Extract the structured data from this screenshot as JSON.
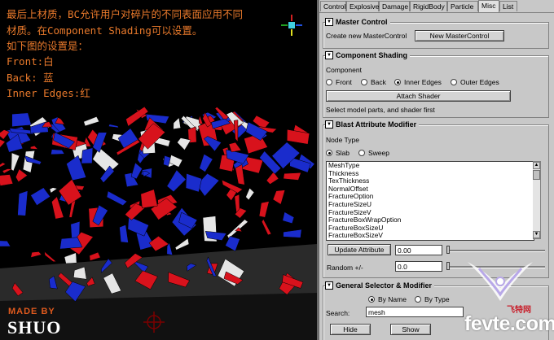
{
  "viewport": {
    "annotation_lines": [
      "最后上材质，BC允许用户对碎片的不同表面应用不同",
      "材质。在Component Shading可以设置。",
      "如下图的设置是：",
      "Front:白",
      "Back: 蓝",
      "Inner Edges:红"
    ],
    "made_by": "MADE BY",
    "signature": "SHUO"
  },
  "tabs": [
    {
      "label": "Control",
      "active": false
    },
    {
      "label": "Explosive",
      "active": false
    },
    {
      "label": "Damage",
      "active": false
    },
    {
      "label": "RigidBody",
      "active": false
    },
    {
      "label": "Particle",
      "active": false
    },
    {
      "label": "Misc",
      "active": true
    },
    {
      "label": "List",
      "active": false
    }
  ],
  "master_control": {
    "title": "Master Control",
    "create_label": "Create new MasterControl",
    "button": "New MasterControl"
  },
  "component_shading": {
    "title": "Component Shading",
    "component_label": "Component",
    "options": [
      {
        "label": "Front",
        "selected": false
      },
      {
        "label": "Back",
        "selected": false
      },
      {
        "label": "Inner Edges",
        "selected": true
      },
      {
        "label": "Outer Edges",
        "selected": false
      }
    ],
    "attach_button": "Attach Shader",
    "hint": "Select model parts, and shader first"
  },
  "blast_attribute_modifier": {
    "title": "Blast Attribute Modifier",
    "node_type_label": "Node Type",
    "node_types": [
      {
        "label": "Slab",
        "selected": true
      },
      {
        "label": "Sweep",
        "selected": false
      }
    ],
    "attributes": [
      "MeshType",
      "Thickness",
      "TexThickness",
      "NormalOffset",
      "FractureOption",
      "FractureSizeU",
      "FractureSizeV",
      "FractureBoxWrapOption",
      "FractureBoxSizeU",
      "FractureBoxSizeV"
    ],
    "update_button": "Update Attribute",
    "value": "0.00",
    "random_label": "Random +/-",
    "random_value": "0.0"
  },
  "general_selector": {
    "title": "General Selector & Modifier",
    "options": [
      {
        "label": "By Name",
        "selected": true
      },
      {
        "label": "By Type",
        "selected": false
      }
    ],
    "search_label": "Search:",
    "search_value": "mesh",
    "hide_button": "Hide",
    "show_button": "Show"
  },
  "watermark": {
    "site": "fevte.com",
    "cn": "飞特网"
  },
  "colors": {
    "annotation": "#e8792b",
    "fragment_red": "#d8121c",
    "fragment_blue": "#1a2ccc",
    "fragment_white": "#e6e6e6",
    "panel_bg": "#c8c8c8"
  }
}
